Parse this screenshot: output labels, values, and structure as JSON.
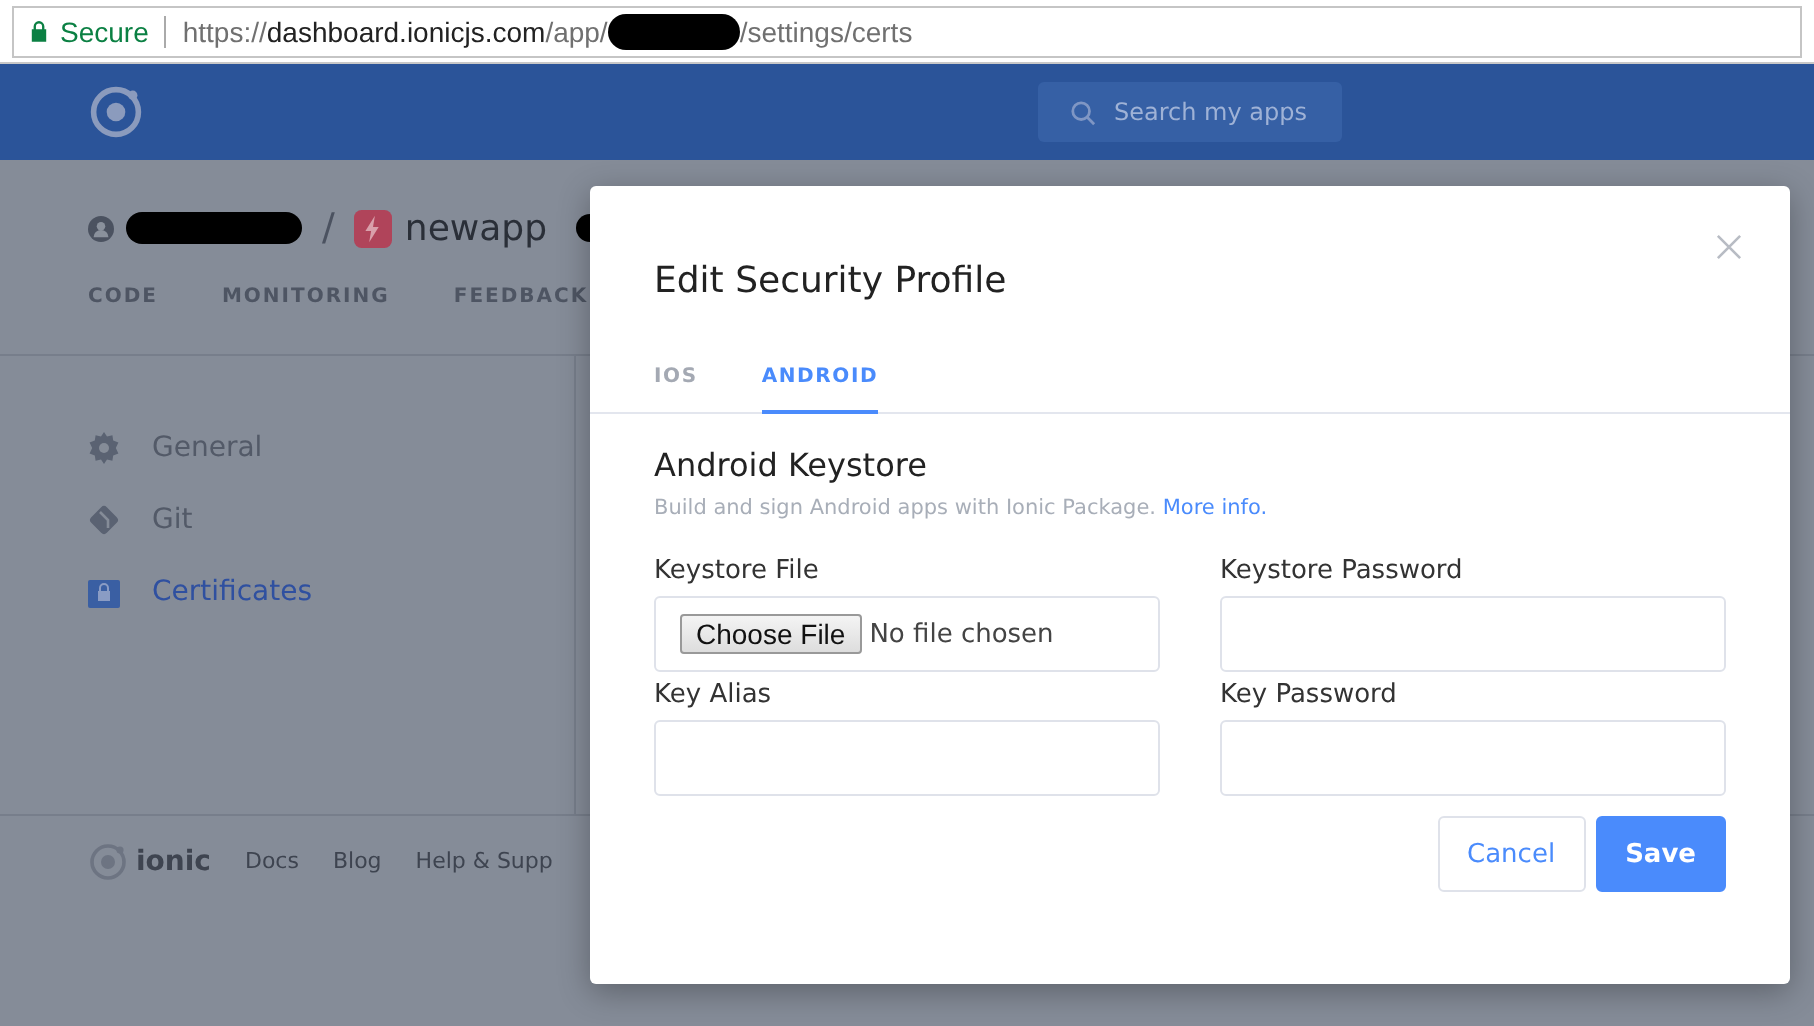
{
  "address_bar": {
    "security": "Secure",
    "url_scheme": "https://",
    "url_host": "dashboard.ionicjs.com",
    "url_path": "/app/",
    "url_tail": "/settings/certs"
  },
  "header": {
    "search": {
      "placeholder": "Search my apps"
    }
  },
  "breadcrumb": {
    "separator": "/",
    "app_name": "newapp"
  },
  "nav_tabs": [
    {
      "label": "CODE",
      "selected": false
    },
    {
      "label": "MONITORING",
      "selected": false
    },
    {
      "label": "FEEDBACK",
      "selected": false
    }
  ],
  "sidebar": {
    "items": [
      {
        "label": "General",
        "kind": "gear",
        "selected": false
      },
      {
        "label": "Git",
        "kind": "git",
        "selected": false
      },
      {
        "label": "Certificates",
        "kind": "lock",
        "selected": true
      }
    ]
  },
  "footer": {
    "brand": "ionic",
    "links": [
      "Docs",
      "Blog",
      "Help & Supp"
    ]
  },
  "modal": {
    "title": "Edit Security Profile",
    "tabs": [
      {
        "label": "IOS",
        "selected": false
      },
      {
        "label": "ANDROID",
        "selected": true
      }
    ],
    "section_title": "Android Keystore",
    "description": "Build and sign Android apps with Ionic Package.",
    "link": "More info.",
    "fields": [
      {
        "label": "Keystore File",
        "kind": "file",
        "button": "Choose File",
        "value": "No file chosen"
      },
      {
        "label": "Keystore Password",
        "kind": "text"
      },
      {
        "label": "Key Alias",
        "kind": "text"
      },
      {
        "label": "Key Password",
        "kind": "text"
      }
    ],
    "buttons": [
      {
        "label": "Cancel",
        "kind": "secondary"
      },
      {
        "label": "Save",
        "kind": "primary"
      }
    ]
  }
}
